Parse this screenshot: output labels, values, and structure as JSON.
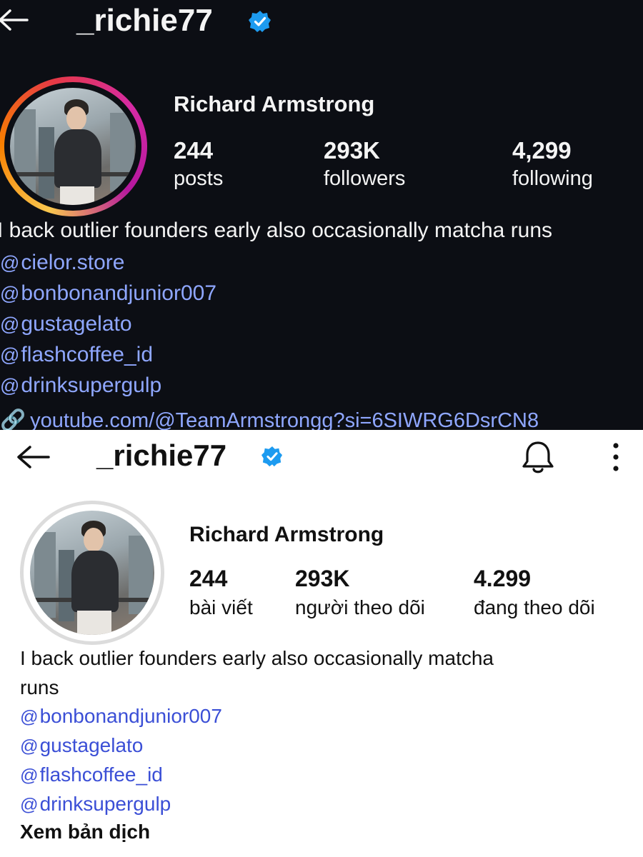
{
  "dark_profile": {
    "username": "_richie77",
    "display_name": "Richard Armstrong",
    "stats": [
      {
        "value": "244",
        "label": "posts"
      },
      {
        "value": "293K",
        "label": "followers"
      },
      {
        "value": "4,299",
        "label": "following"
      }
    ],
    "bio": "I back outlier founders early also occasionally matcha runs",
    "links": [
      "cielor.store",
      "bonbonandjunior007",
      "gustagelato",
      "flashcoffee_id",
      "drinksupergulp"
    ],
    "youtube": "youtube.com/@TeamArmstrongg?si=6SIWRG6DsrCN8"
  },
  "light_profile": {
    "username": "_richie77",
    "display_name": "Richard Armstrong",
    "stats": [
      {
        "value": "244",
        "label": "bài viết"
      },
      {
        "value": "293K",
        "label": "người theo dõi"
      },
      {
        "value": "4.299",
        "label": "đang theo dõi"
      }
    ],
    "bio_line1": "I back outlier founders early also occasionally matcha",
    "bio_line2": "runs",
    "links": [
      "bonbonandjunior007",
      "gustagelato",
      "flashcoffee_id",
      "drinksupergulp"
    ],
    "translate": "Xem bản dịch"
  },
  "colors": {
    "dark_bg": "#0c0e14",
    "verified_blue": "#1d9bf0",
    "link_dark": "#8fa7ff",
    "link_light": "#3b4fd6",
    "story_ring_start": "#f9c74f",
    "story_ring_end": "#d62ba5"
  },
  "icons": {
    "back": "back-arrow-icon",
    "verified": "verified-badge-icon",
    "bell": "bell-icon",
    "more": "more-vertical-icon",
    "threads": "threads-icon",
    "link": "link-icon"
  }
}
